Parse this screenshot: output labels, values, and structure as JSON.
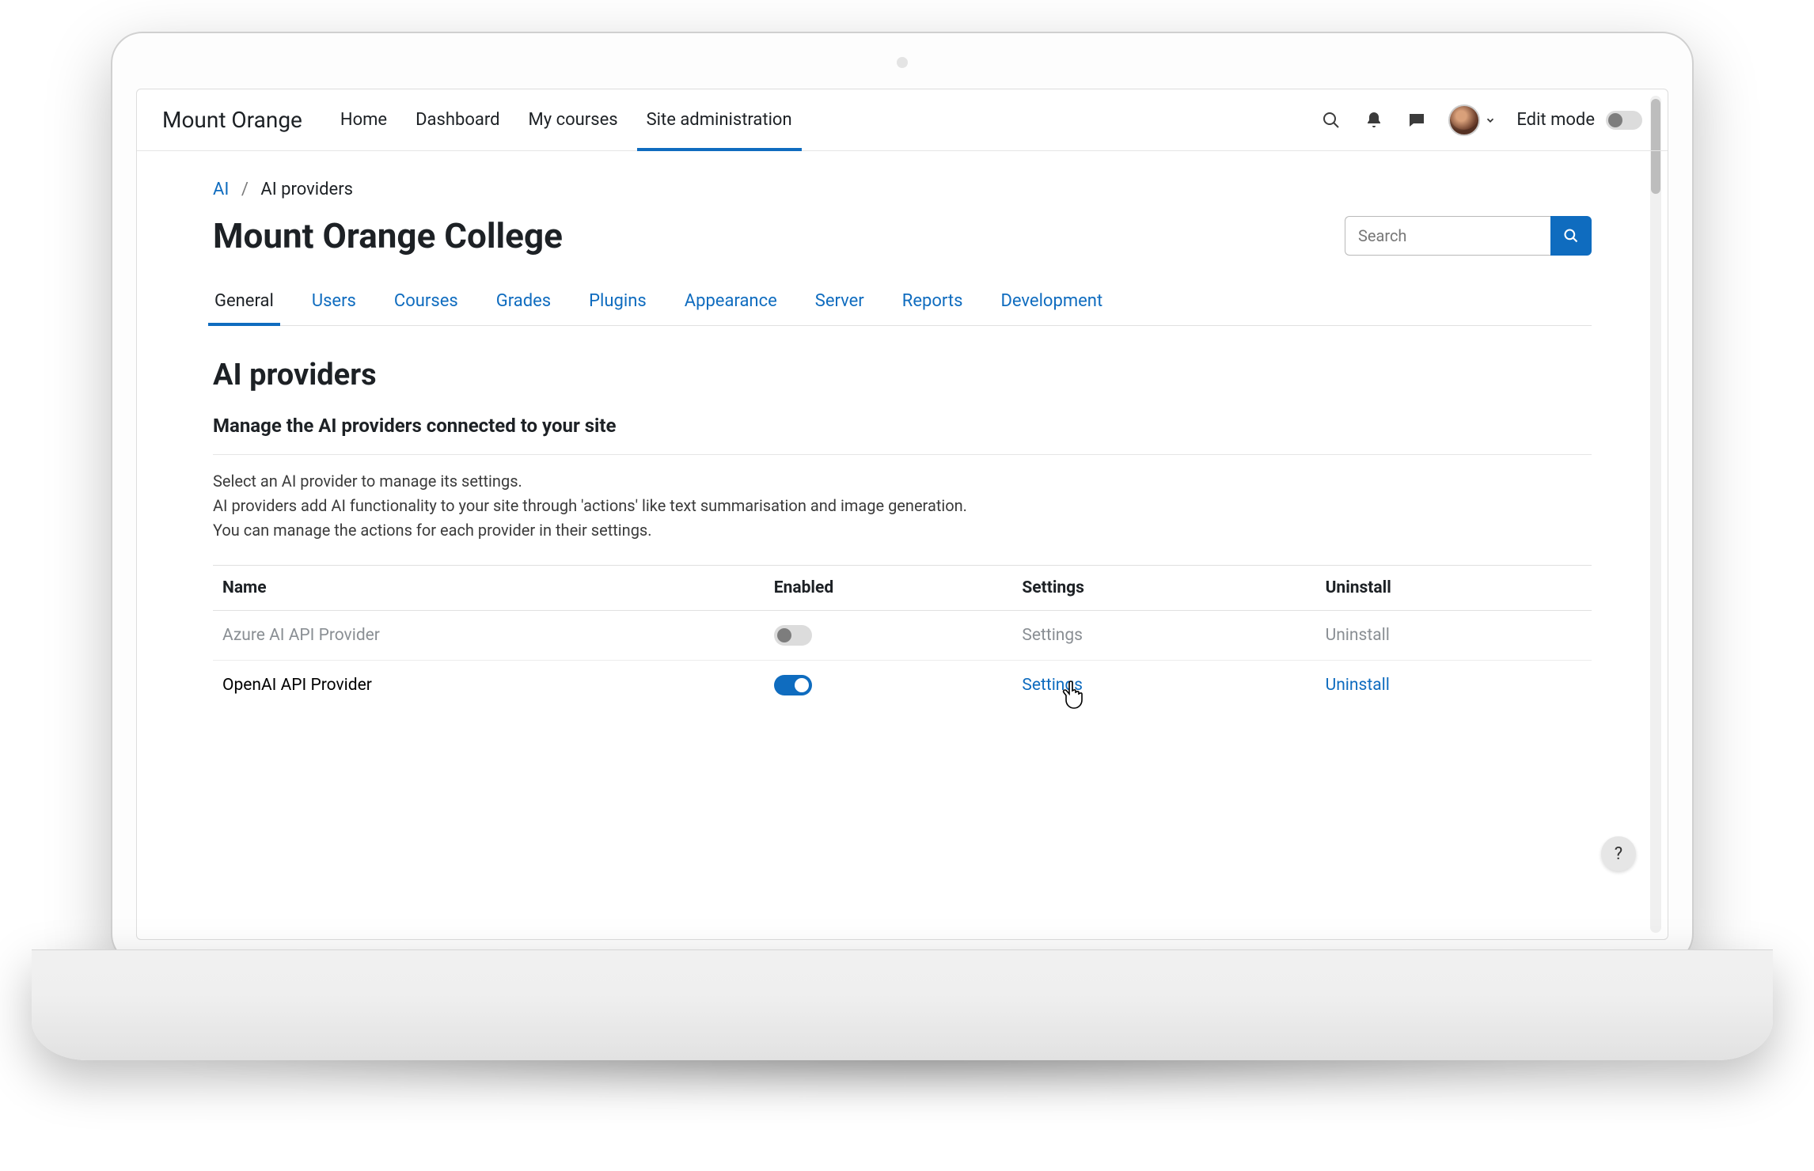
{
  "brand": "Mount Orange",
  "topnav": {
    "items": [
      {
        "label": "Home"
      },
      {
        "label": "Dashboard"
      },
      {
        "label": "My courses"
      },
      {
        "label": "Site administration",
        "active": true
      }
    ],
    "editmode_label": "Edit mode"
  },
  "search": {
    "placeholder": "Search"
  },
  "breadcrumb": {
    "root": "AI",
    "leaf": "AI providers"
  },
  "page_title": "Mount Orange College",
  "admin_tabs": [
    {
      "label": "General",
      "active": true
    },
    {
      "label": "Users"
    },
    {
      "label": "Courses"
    },
    {
      "label": "Grades"
    },
    {
      "label": "Plugins"
    },
    {
      "label": "Appearance"
    },
    {
      "label": "Server"
    },
    {
      "label": "Reports"
    },
    {
      "label": "Development"
    }
  ],
  "section": {
    "title": "AI providers",
    "subtitle": "Manage the AI providers connected to your site",
    "desc1": "Select an AI provider to manage its settings.",
    "desc2": "AI providers add AI functionality to your site through 'actions' like text summarisation and image generation.",
    "desc3": "You can manage the actions for each provider in their settings."
  },
  "table": {
    "headers": {
      "name": "Name",
      "enabled": "Enabled",
      "settings": "Settings",
      "uninstall": "Uninstall"
    },
    "rows": [
      {
        "name": "Azure AI API Provider",
        "enabled": false,
        "settings": "Settings",
        "uninstall": "Uninstall"
      },
      {
        "name": "OpenAI API Provider",
        "enabled": true,
        "settings": "Settings",
        "uninstall": "Uninstall"
      }
    ]
  },
  "help_label": "?"
}
